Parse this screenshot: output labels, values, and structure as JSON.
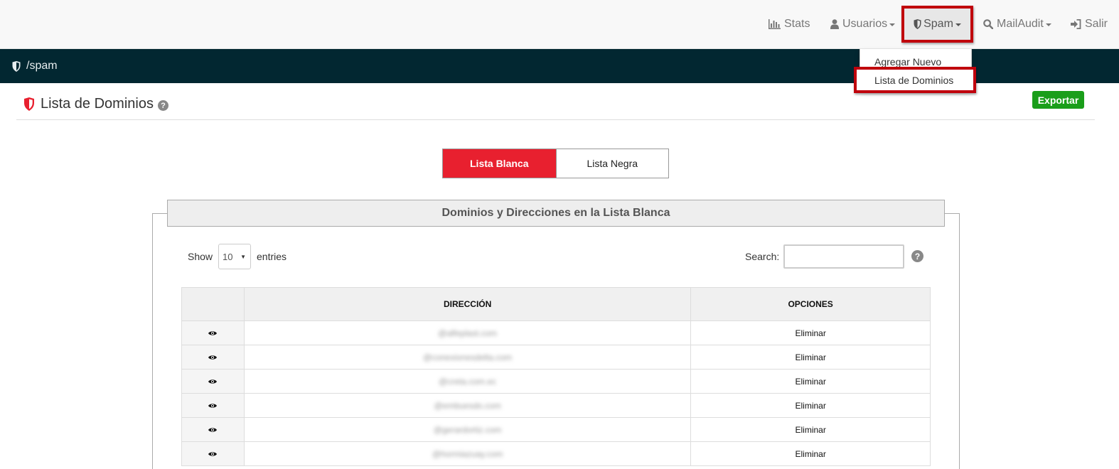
{
  "nav": {
    "stats": "Stats",
    "usuarios": "Usuarios",
    "spam": "Spam",
    "mailaudit": "MailAudit",
    "salir": "Salir"
  },
  "path": "/spam",
  "dropdown": {
    "agregar_nuevo": "Agregar Nuevo",
    "lista_dominios": "Lista de Dominios"
  },
  "page": {
    "title": "Lista de Dominios",
    "help": "?",
    "export_label": "Exportar"
  },
  "toggle": {
    "blanca": "Lista Blanca",
    "negra": "Lista Negra"
  },
  "panel": {
    "heading": "Dominios y Direcciones en la Lista Blanca",
    "show": "Show",
    "entries_value": "10",
    "entries": "entries",
    "search": "Search:",
    "search_value": ""
  },
  "table": {
    "headers": [
      "",
      "DIRECCIÓN",
      "OPCIONES"
    ],
    "rows": [
      {
        "address": "@alfeplast.com",
        "option": "Eliminar"
      },
      {
        "address": "@conexionesdelta.com",
        "option": "Eliminar"
      },
      {
        "address": "@creta.com.ec",
        "option": "Eliminar"
      },
      {
        "address": "@embuesdo.com",
        "option": "Eliminar"
      },
      {
        "address": "@gerardortiz.com",
        "option": "Eliminar"
      },
      {
        "address": "@hormiazuay.com",
        "option": "Eliminar"
      }
    ]
  },
  "colors": {
    "navbar_bg": "#f8f8f8",
    "pathbar_bg": "#022731",
    "accent_red": "#e8202f",
    "highlight_red": "#c0000c",
    "export_green": "#1a9e1a"
  },
  "icons": {
    "stats": "bar-chart-icon",
    "usuarios": "user-icon",
    "spam": "shield-icon",
    "mailaudit": "search-icon",
    "salir": "sign-in-icon",
    "row": "eye-icon"
  }
}
